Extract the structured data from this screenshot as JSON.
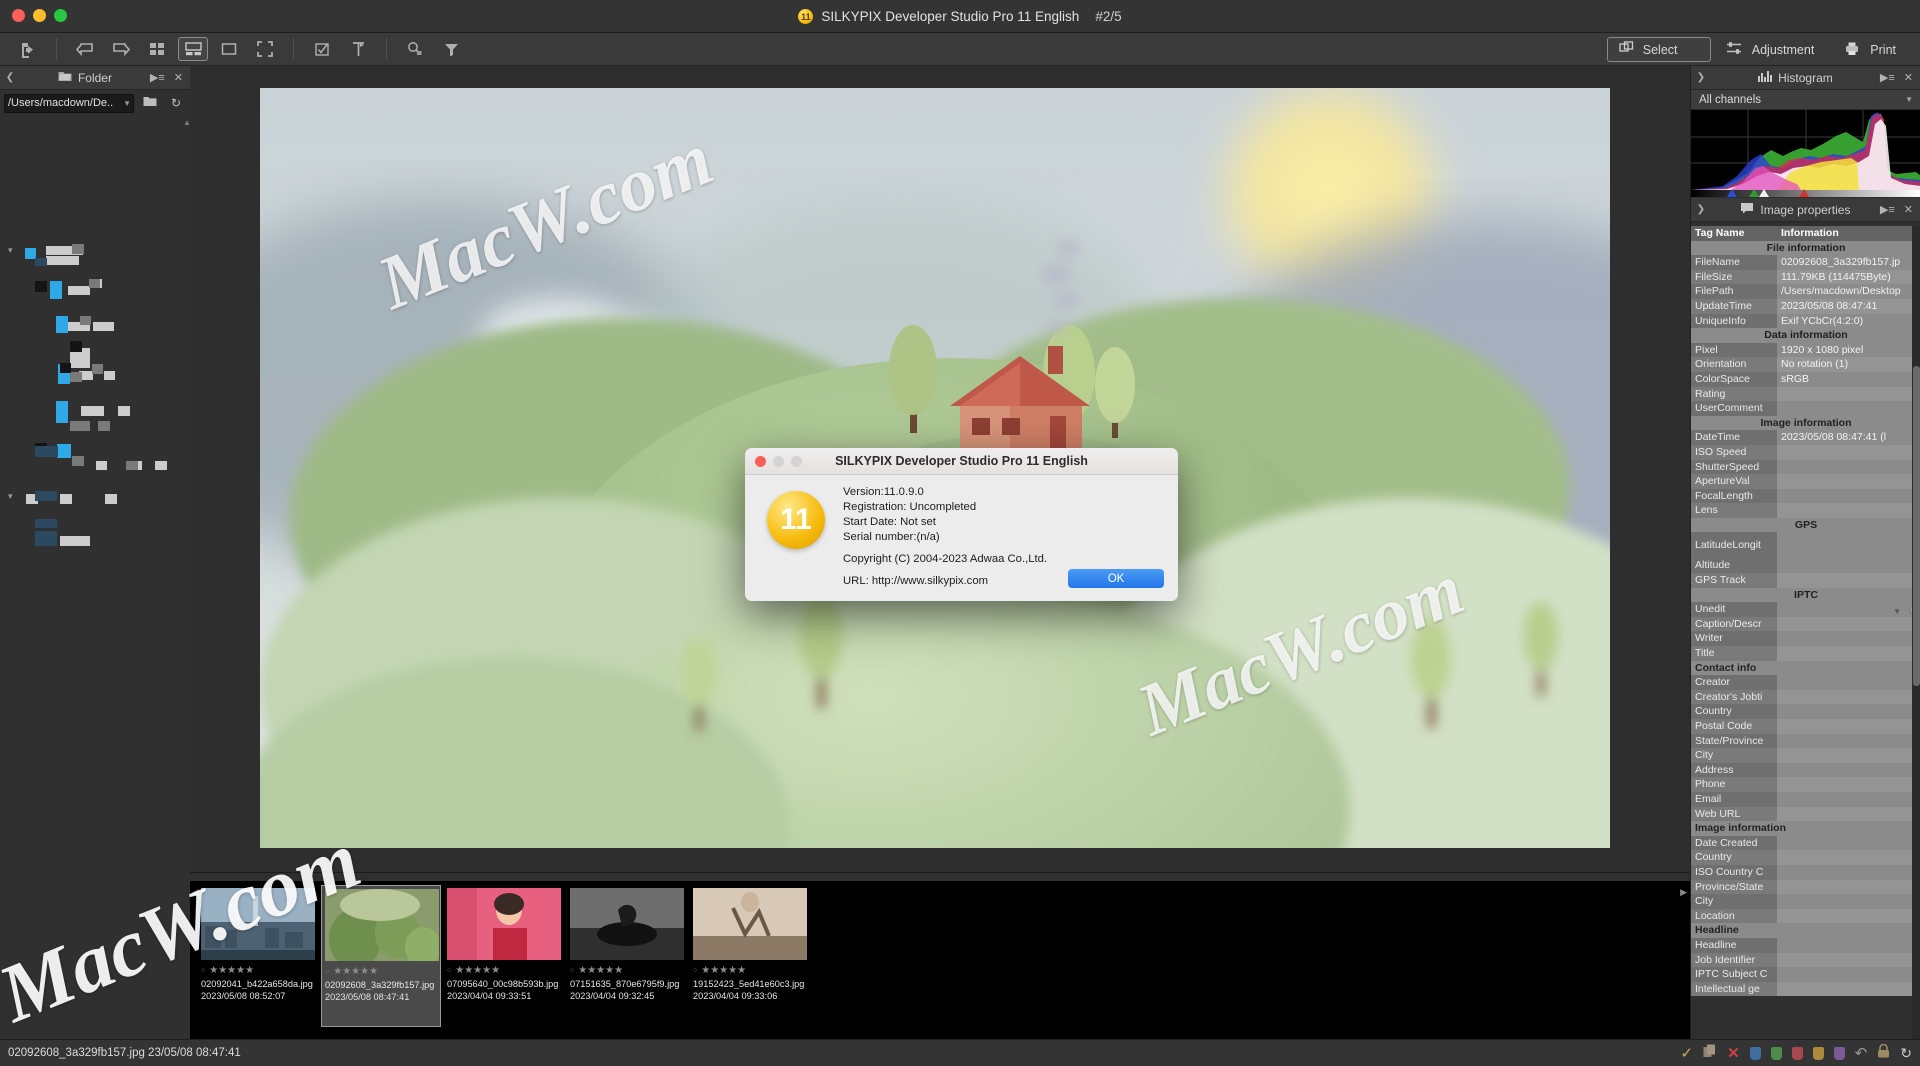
{
  "titlebar": {
    "app_title": "SILKYPIX Developer Studio Pro 11 English",
    "image_counter": "#2/5",
    "badge": "11"
  },
  "toolbar": {
    "left_icons": [
      {
        "name": "export-icon",
        "label": "Export"
      },
      {
        "name": "rotate-left-icon",
        "label": "Rotate left"
      },
      {
        "name": "rotate-right-icon",
        "label": "Rotate right"
      },
      {
        "name": "grid-view-icon",
        "label": "Grid view"
      },
      {
        "name": "filmstrip-view-icon",
        "label": "Filmstrip view"
      },
      {
        "name": "single-view-icon",
        "label": "Single view"
      },
      {
        "name": "fullscreen-icon",
        "label": "Full screen"
      },
      {
        "name": "checkbox-select-icon",
        "label": "Mark"
      },
      {
        "name": "hammer-icon",
        "label": "Tools"
      },
      {
        "name": "search-magnifier-icon",
        "label": "Search"
      },
      {
        "name": "filter-funnel-icon",
        "label": "Filter"
      }
    ],
    "modes": [
      {
        "name": "select",
        "label": "Select",
        "icon": "select-icon",
        "active": true
      },
      {
        "name": "adjustment",
        "label": "Adjustment",
        "icon": "sliders-icon",
        "active": false
      },
      {
        "name": "print",
        "label": "Print",
        "icon": "printer-icon",
        "active": false
      }
    ]
  },
  "folder_panel": {
    "title": "Folder",
    "path_value": "/Users/macdown/De..",
    "collapse_icon": "chevron-left-icon",
    "folder_icon": "folder-icon",
    "menu_icon": "panel-menu-icon",
    "close_icon": "close-icon",
    "new_folder_icon": "new-folder-icon",
    "refresh_icon": "refresh-icon"
  },
  "histogram_panel": {
    "title": "Histogram",
    "channel_selector": "All channels",
    "icon": "histogram-icon"
  },
  "image_properties_panel": {
    "title": "Image properties",
    "icon": "properties-icon",
    "columns": [
      "Tag Name",
      "Information"
    ],
    "sections": [
      {
        "heading": "File information",
        "rows": [
          {
            "key": "FileName",
            "value": "02092608_3a329fb157.jp"
          },
          {
            "key": "FileSize",
            "value": "111.79KB (114475Byte)"
          },
          {
            "key": "FilePath",
            "value": "/Users/macdown/Desktop"
          },
          {
            "key": "UpdateTime",
            "value": "2023/05/08 08:47:41"
          },
          {
            "key": "UniqueInfo",
            "value": "Exif YCbCr(4:2:0)"
          }
        ]
      },
      {
        "heading": "Data information",
        "rows": [
          {
            "key": "Pixel",
            "value": "1920 x 1080 pixel"
          },
          {
            "key": "Orientation",
            "value": "No rotation (1)"
          },
          {
            "key": "ColorSpace",
            "value": "sRGB"
          },
          {
            "key": "Rating",
            "value": ""
          },
          {
            "key": "UserComment",
            "value": ""
          }
        ]
      },
      {
        "heading": "Image information",
        "rows": [
          {
            "key": "DateTime",
            "value": "2023/05/08 08:47:41 (l"
          },
          {
            "key": "ISO Speed",
            "value": ""
          },
          {
            "key": "ShutterSpeed",
            "value": ""
          },
          {
            "key": "ApertureVal",
            "value": ""
          },
          {
            "key": "FocalLength",
            "value": ""
          },
          {
            "key": "Lens",
            "value": ""
          }
        ]
      },
      {
        "heading": "GPS",
        "rows": [
          {
            "key": "LatitudeLongit",
            "value": "",
            "tall": true
          },
          {
            "key": "Altitude",
            "value": ""
          },
          {
            "key": "GPS Track",
            "value": ""
          }
        ]
      },
      {
        "heading": "IPTC",
        "rows": [
          {
            "key": "Unedit",
            "value": "",
            "select": true
          },
          {
            "key": "Caption/Descr",
            "value": ""
          },
          {
            "key": "Writer",
            "value": ""
          },
          {
            "key": "Title",
            "value": ""
          }
        ]
      },
      {
        "subheading": "Contact info",
        "rows": [
          {
            "key": "Creator",
            "value": ""
          },
          {
            "key": "Creator's Jobti",
            "value": ""
          },
          {
            "key": "Country",
            "value": ""
          },
          {
            "key": "Postal Code",
            "value": ""
          },
          {
            "key": "State/Province",
            "value": ""
          },
          {
            "key": "City",
            "value": ""
          },
          {
            "key": "Address",
            "value": ""
          },
          {
            "key": "Phone",
            "value": ""
          },
          {
            "key": "Email",
            "value": ""
          },
          {
            "key": "Web URL",
            "value": ""
          }
        ]
      },
      {
        "subheading": "Image information",
        "rows": [
          {
            "key": "Date Created",
            "value": ""
          },
          {
            "key": "Country",
            "value": ""
          },
          {
            "key": "ISO Country C",
            "value": ""
          },
          {
            "key": "Province/State",
            "value": ""
          },
          {
            "key": "City",
            "value": ""
          },
          {
            "key": "Location",
            "value": ""
          }
        ]
      },
      {
        "subheading": "Headline",
        "rows": [
          {
            "key": "Headline",
            "value": ""
          },
          {
            "key": "Job Identifier",
            "value": ""
          },
          {
            "key": "IPTC Subject C",
            "value": ""
          },
          {
            "key": "Intellectual ge",
            "value": ""
          }
        ]
      }
    ]
  },
  "filmstrip": {
    "items": [
      {
        "filename": "02092041_b422a658da.jpg",
        "date": "2023/05/08 08:52:07",
        "stars": 5,
        "selected": false,
        "thumb": "city"
      },
      {
        "filename": "02092608_3a329fb157.jpg",
        "date": "2023/05/08 08:47:41",
        "stars": 5,
        "selected": true,
        "thumb": "cactus"
      },
      {
        "filename": "07095640_00c98b593b.jpg",
        "date": "2023/04/04 09:33:51",
        "stars": 5,
        "selected": false,
        "thumb": "portrait"
      },
      {
        "filename": "07151635_870e6795f9.jpg",
        "date": "2023/04/04 09:32:45",
        "stars": 5,
        "selected": false,
        "thumb": "mono"
      },
      {
        "filename": "19152423_5ed41e60c3.jpg",
        "date": "2023/04/04 09:33:06",
        "stars": 5,
        "selected": false,
        "thumb": "dance"
      }
    ]
  },
  "statusbar": {
    "text": "02092608_3a329fb157.jpg 23/05/08 08:47:41",
    "icons": [
      {
        "name": "check-icon",
        "color": "#c8ae54"
      },
      {
        "name": "copy-icon",
        "color": "#8e8370"
      },
      {
        "name": "delete-x-icon",
        "color": "#cf4040"
      },
      {
        "name": "tag-blue-icon",
        "color": "#3f6f9e"
      },
      {
        "name": "tag-green-icon",
        "color": "#4d8c4a"
      },
      {
        "name": "tag-red-icon",
        "color": "#a8474f"
      },
      {
        "name": "tag-yellow-icon",
        "color": "#ab8a3c"
      },
      {
        "name": "tag-purple-icon",
        "color": "#7b5b93"
      },
      {
        "name": "undo-icon",
        "color": "#9a9a9a"
      },
      {
        "name": "lock-icon",
        "color": "#9d8a62"
      },
      {
        "name": "sync-icon",
        "color": "#cfcfcf"
      }
    ]
  },
  "dialog": {
    "title": "SILKYPIX Developer Studio Pro 11 English",
    "badge": "11",
    "lines": [
      "Version:11.0.9.0",
      "Registration: Uncompleted",
      "Start Date: Not set",
      "Serial number:(n/a)"
    ],
    "copyright": "Copyright (C) 2004-2023 Adwaa Co.,Ltd.",
    "url": "URL: http://www.silkypix.com",
    "ok_label": "OK"
  },
  "watermarks": {
    "main": "MacW.com",
    "right": "MacW.com",
    "corner": "MacW.com"
  }
}
